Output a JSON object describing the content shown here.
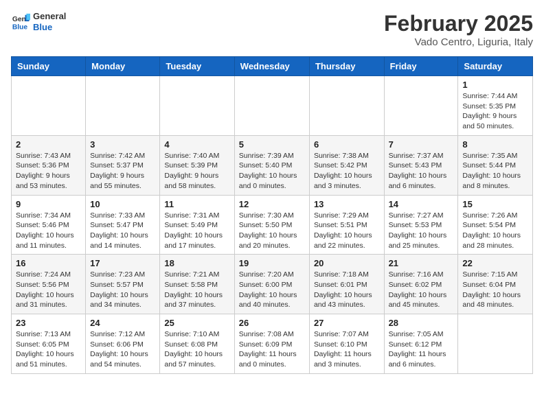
{
  "header": {
    "logo_line1": "General",
    "logo_line2": "Blue",
    "title": "February 2025",
    "subtitle": "Vado Centro, Liguria, Italy"
  },
  "days_of_week": [
    "Sunday",
    "Monday",
    "Tuesday",
    "Wednesday",
    "Thursday",
    "Friday",
    "Saturday"
  ],
  "weeks": [
    [
      {
        "day": "",
        "info": ""
      },
      {
        "day": "",
        "info": ""
      },
      {
        "day": "",
        "info": ""
      },
      {
        "day": "",
        "info": ""
      },
      {
        "day": "",
        "info": ""
      },
      {
        "day": "",
        "info": ""
      },
      {
        "day": "1",
        "info": "Sunrise: 7:44 AM\nSunset: 5:35 PM\nDaylight: 9 hours and 50 minutes."
      }
    ],
    [
      {
        "day": "2",
        "info": "Sunrise: 7:43 AM\nSunset: 5:36 PM\nDaylight: 9 hours and 53 minutes."
      },
      {
        "day": "3",
        "info": "Sunrise: 7:42 AM\nSunset: 5:37 PM\nDaylight: 9 hours and 55 minutes."
      },
      {
        "day": "4",
        "info": "Sunrise: 7:40 AM\nSunset: 5:39 PM\nDaylight: 9 hours and 58 minutes."
      },
      {
        "day": "5",
        "info": "Sunrise: 7:39 AM\nSunset: 5:40 PM\nDaylight: 10 hours and 0 minutes."
      },
      {
        "day": "6",
        "info": "Sunrise: 7:38 AM\nSunset: 5:42 PM\nDaylight: 10 hours and 3 minutes."
      },
      {
        "day": "7",
        "info": "Sunrise: 7:37 AM\nSunset: 5:43 PM\nDaylight: 10 hours and 6 minutes."
      },
      {
        "day": "8",
        "info": "Sunrise: 7:35 AM\nSunset: 5:44 PM\nDaylight: 10 hours and 8 minutes."
      }
    ],
    [
      {
        "day": "9",
        "info": "Sunrise: 7:34 AM\nSunset: 5:46 PM\nDaylight: 10 hours and 11 minutes."
      },
      {
        "day": "10",
        "info": "Sunrise: 7:33 AM\nSunset: 5:47 PM\nDaylight: 10 hours and 14 minutes."
      },
      {
        "day": "11",
        "info": "Sunrise: 7:31 AM\nSunset: 5:49 PM\nDaylight: 10 hours and 17 minutes."
      },
      {
        "day": "12",
        "info": "Sunrise: 7:30 AM\nSunset: 5:50 PM\nDaylight: 10 hours and 20 minutes."
      },
      {
        "day": "13",
        "info": "Sunrise: 7:29 AM\nSunset: 5:51 PM\nDaylight: 10 hours and 22 minutes."
      },
      {
        "day": "14",
        "info": "Sunrise: 7:27 AM\nSunset: 5:53 PM\nDaylight: 10 hours and 25 minutes."
      },
      {
        "day": "15",
        "info": "Sunrise: 7:26 AM\nSunset: 5:54 PM\nDaylight: 10 hours and 28 minutes."
      }
    ],
    [
      {
        "day": "16",
        "info": "Sunrise: 7:24 AM\nSunset: 5:56 PM\nDaylight: 10 hours and 31 minutes."
      },
      {
        "day": "17",
        "info": "Sunrise: 7:23 AM\nSunset: 5:57 PM\nDaylight: 10 hours and 34 minutes."
      },
      {
        "day": "18",
        "info": "Sunrise: 7:21 AM\nSunset: 5:58 PM\nDaylight: 10 hours and 37 minutes."
      },
      {
        "day": "19",
        "info": "Sunrise: 7:20 AM\nSunset: 6:00 PM\nDaylight: 10 hours and 40 minutes."
      },
      {
        "day": "20",
        "info": "Sunrise: 7:18 AM\nSunset: 6:01 PM\nDaylight: 10 hours and 43 minutes."
      },
      {
        "day": "21",
        "info": "Sunrise: 7:16 AM\nSunset: 6:02 PM\nDaylight: 10 hours and 45 minutes."
      },
      {
        "day": "22",
        "info": "Sunrise: 7:15 AM\nSunset: 6:04 PM\nDaylight: 10 hours and 48 minutes."
      }
    ],
    [
      {
        "day": "23",
        "info": "Sunrise: 7:13 AM\nSunset: 6:05 PM\nDaylight: 10 hours and 51 minutes."
      },
      {
        "day": "24",
        "info": "Sunrise: 7:12 AM\nSunset: 6:06 PM\nDaylight: 10 hours and 54 minutes."
      },
      {
        "day": "25",
        "info": "Sunrise: 7:10 AM\nSunset: 6:08 PM\nDaylight: 10 hours and 57 minutes."
      },
      {
        "day": "26",
        "info": "Sunrise: 7:08 AM\nSunset: 6:09 PM\nDaylight: 11 hours and 0 minutes."
      },
      {
        "day": "27",
        "info": "Sunrise: 7:07 AM\nSunset: 6:10 PM\nDaylight: 11 hours and 3 minutes."
      },
      {
        "day": "28",
        "info": "Sunrise: 7:05 AM\nSunset: 6:12 PM\nDaylight: 11 hours and 6 minutes."
      },
      {
        "day": "",
        "info": ""
      }
    ]
  ]
}
